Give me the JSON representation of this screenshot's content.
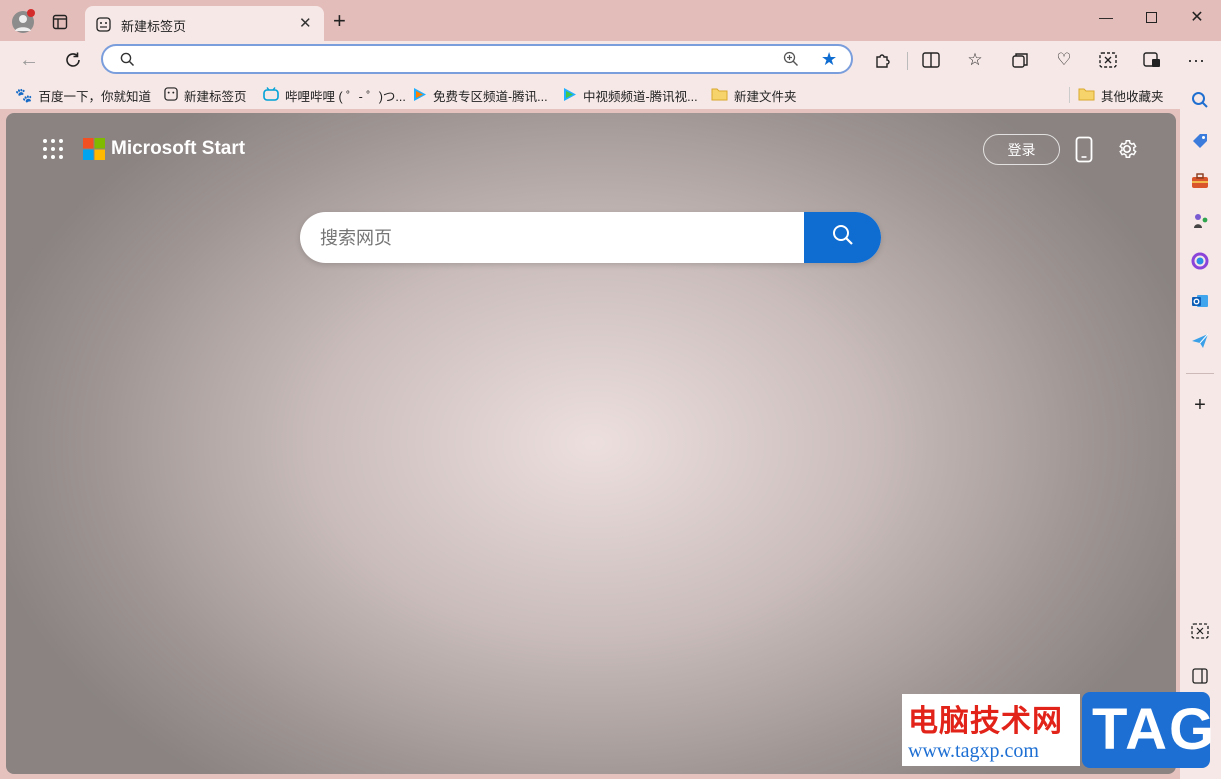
{
  "tab": {
    "title": "新建标签页"
  },
  "address": {
    "value": "",
    "placeholder": ""
  },
  "bookmarks": [
    {
      "label": "百度一下，你就知道",
      "icon": "baidu-icon"
    },
    {
      "label": "新建标签页",
      "icon": "newtab-icon"
    },
    {
      "label": "哔哩哔哩 ( ゜- ゜)つ...",
      "icon": "bilibili-icon"
    },
    {
      "label": "免费专区频道-腾讯...",
      "icon": "tencent-video-icon"
    },
    {
      "label": "中视频频道-腾讯视...",
      "icon": "tencent-video-icon"
    },
    {
      "label": "新建文件夹",
      "icon": "folder-icon"
    }
  ],
  "other_bookmarks": "其他收藏夹",
  "page": {
    "brand": "Microsoft Start",
    "login": "登录",
    "search_placeholder": "搜索网页"
  },
  "watermark": {
    "title": "电脑技术网",
    "url": "www.tagxp.com",
    "logo": "TAG"
  },
  "colors": {
    "accent": "#0f6cd1",
    "titlebar": "#e3bdb9",
    "toolbar": "#f6e8e7"
  }
}
